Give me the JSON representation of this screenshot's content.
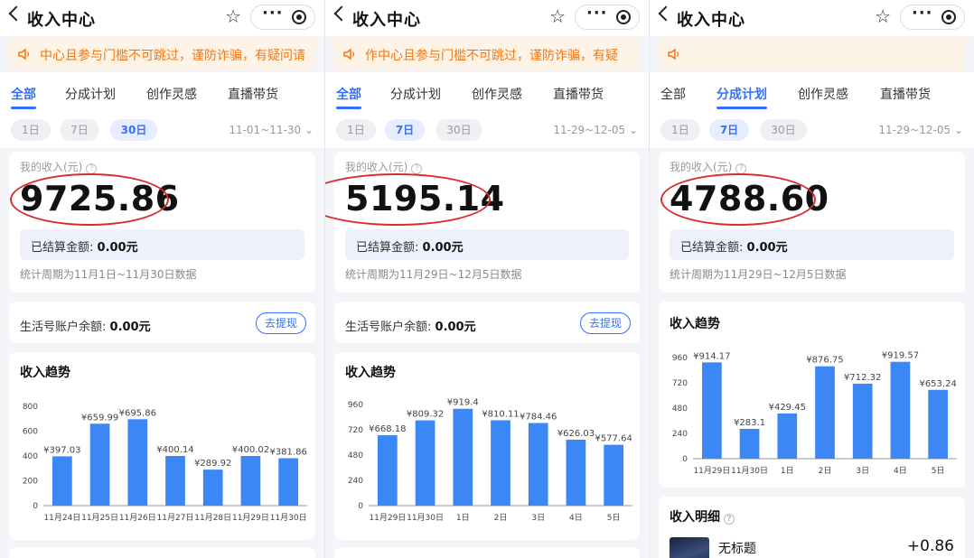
{
  "common": {
    "title": "收入中心",
    "tabs": [
      "全部",
      "分成计划",
      "创作灵感",
      "直播带货"
    ],
    "pills": [
      "1日",
      "7日",
      "30日"
    ],
    "income_label": "我的收入(元)",
    "settled_label": "已结算金额:",
    "settled_value": "0.00元",
    "balance_label": "生活号账户余额:",
    "balance_value": "0.00元",
    "withdraw_label": "去提现",
    "trend_title": "收入趋势",
    "detail_title": "收入明细",
    "help_glyph": "?"
  },
  "panels": [
    {
      "notice": "中心且参与门槛不可跳过，谨防诈骗，有疑问请",
      "active_tab": 0,
      "active_pill": 2,
      "date_range": "11-01~11-30",
      "income": "9725.86",
      "period": "统计周期为11月1日~11月30日数据",
      "show_balance": true
    },
    {
      "notice": "作中心且参与门槛不可跳过，谨防诈骗，有疑",
      "active_tab": 0,
      "active_pill": 1,
      "date_range": "11-29~12-05",
      "income": "5195.14",
      "period": "统计周期为11月29日~12月5日数据",
      "show_balance": true
    },
    {
      "notice": "",
      "active_tab": 1,
      "active_pill": 1,
      "date_range": "11-29~12-05",
      "income": "4788.60",
      "period": "统计周期为11月29日~12月5日数据",
      "show_balance": false,
      "detail_item": {
        "title": "无标题",
        "amount": "+0.86"
      }
    }
  ],
  "colors": {
    "accent": "#3370ff",
    "bar": "#3a87f5",
    "notice_text": "#f5760f",
    "highlight_ellipse": "#d92b2b"
  },
  "chart_data": [
    {
      "type": "bar",
      "categories": [
        "11月24日",
        "11月25日",
        "11月26日",
        "11月27日",
        "11月28日",
        "11月29日",
        "11月30日"
      ],
      "values": [
        397.03,
        659.99,
        695.86,
        400.14,
        289.92,
        400.02,
        381.86
      ],
      "value_labels": [
        "¥397.03",
        "¥659.99",
        "¥695.86",
        "¥400.14",
        "¥289.92",
        "¥400.02",
        "¥381.86"
      ],
      "ylim": [
        0,
        800
      ],
      "yticks": [
        0,
        200,
        400,
        600,
        800
      ],
      "grid": false
    },
    {
      "type": "bar",
      "categories": [
        "11月29日",
        "11月30日",
        "1日",
        "2日",
        "3日",
        "4日",
        "5日"
      ],
      "values": [
        668.18,
        809.32,
        919.4,
        810.11,
        784.46,
        626.03,
        577.64
      ],
      "value_labels": [
        "¥668.18",
        "¥809.32",
        "¥919.4",
        "¥810.11",
        "¥784.46",
        "¥626.03",
        "¥577.64"
      ],
      "ylim": [
        0,
        960
      ],
      "yticks": [
        0,
        240,
        480,
        720,
        960
      ],
      "grid": false
    },
    {
      "type": "bar",
      "categories": [
        "11月29日",
        "11月30日",
        "1日",
        "2日",
        "3日",
        "4日",
        "5日"
      ],
      "values": [
        914.17,
        283.1,
        429.45,
        876.75,
        712.32,
        919.57,
        653.24
      ],
      "value_labels": [
        "¥914.17",
        "¥283.1",
        "¥429.45",
        "¥876.75",
        "¥712.32",
        "¥919.57",
        "¥653.24"
      ],
      "ylim": [
        0,
        960
      ],
      "yticks": [
        0,
        240,
        480,
        720,
        960
      ],
      "grid": false
    }
  ]
}
